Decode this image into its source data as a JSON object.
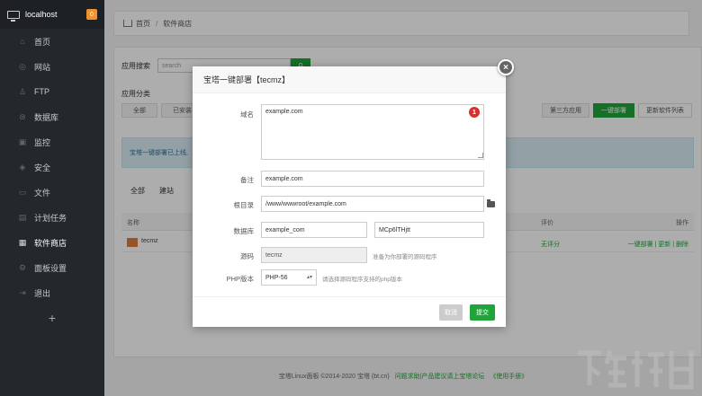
{
  "sidebar": {
    "host": "localhost",
    "badge": "0",
    "items": [
      {
        "label": "首页",
        "icon": "home-icon"
      },
      {
        "label": "网站",
        "icon": "globe-icon"
      },
      {
        "label": "FTP",
        "icon": "user-icon"
      },
      {
        "label": "数据库",
        "icon": "database-icon"
      },
      {
        "label": "监控",
        "icon": "monitor-icon"
      },
      {
        "label": "安全",
        "icon": "shield-icon"
      },
      {
        "label": "文件",
        "icon": "folder-icon"
      },
      {
        "label": "计划任务",
        "icon": "calendar-icon"
      },
      {
        "label": "软件商店",
        "icon": "grid-icon"
      },
      {
        "label": "面板设置",
        "icon": "gear-icon"
      },
      {
        "label": "退出",
        "icon": "logout-icon"
      }
    ],
    "plus": "+"
  },
  "breadcrumb": {
    "home": "首页",
    "sep": "/",
    "current": "软件商店"
  },
  "store": {
    "search_label": "应用搜索",
    "search_placeholder": "search",
    "category_label": "应用分类",
    "categories_left": [
      "全部",
      "已安装"
    ],
    "categories_right": [
      "第三方应用",
      "一键部署",
      "更新软件列表"
    ],
    "notice": "宝塔一键部署已上线,",
    "tabs": [
      "全部",
      "建站"
    ],
    "table_headers": {
      "name": "名称",
      "rating": "评价",
      "ops": "操作"
    },
    "row": {
      "name": "tecmz",
      "rating": "无评分",
      "ops": "一键部署 | 更新 | 删除"
    }
  },
  "footer": {
    "copyright": "宝塔Linux面板 ©2014-2020 宝塔 (bt.cn)",
    "links": "问题求助|产品建议请上宝塔论坛",
    "manual": "《使用手册》"
  },
  "modal": {
    "title": "宝塔一键部署【tecmz】",
    "close": "×",
    "domain_label": "域名",
    "domain_value": "example.com",
    "error_count": "1",
    "remark_label": "备注",
    "remark_value": "example.com",
    "root_label": "根目录",
    "root_value": "/www/wwwroot/example.com",
    "db_label": "数据库",
    "db_name": "example_com",
    "db_pass": "MCp6lTHjtt",
    "source_label": "源码",
    "source_value": "tecmz",
    "source_hint": "准备为你部署的源码程序",
    "php_label": "PHP版本",
    "php_value": "PHP-56",
    "php_hint": "请选择源码程序支持的php版本",
    "cancel": "取消",
    "submit": "提交"
  }
}
